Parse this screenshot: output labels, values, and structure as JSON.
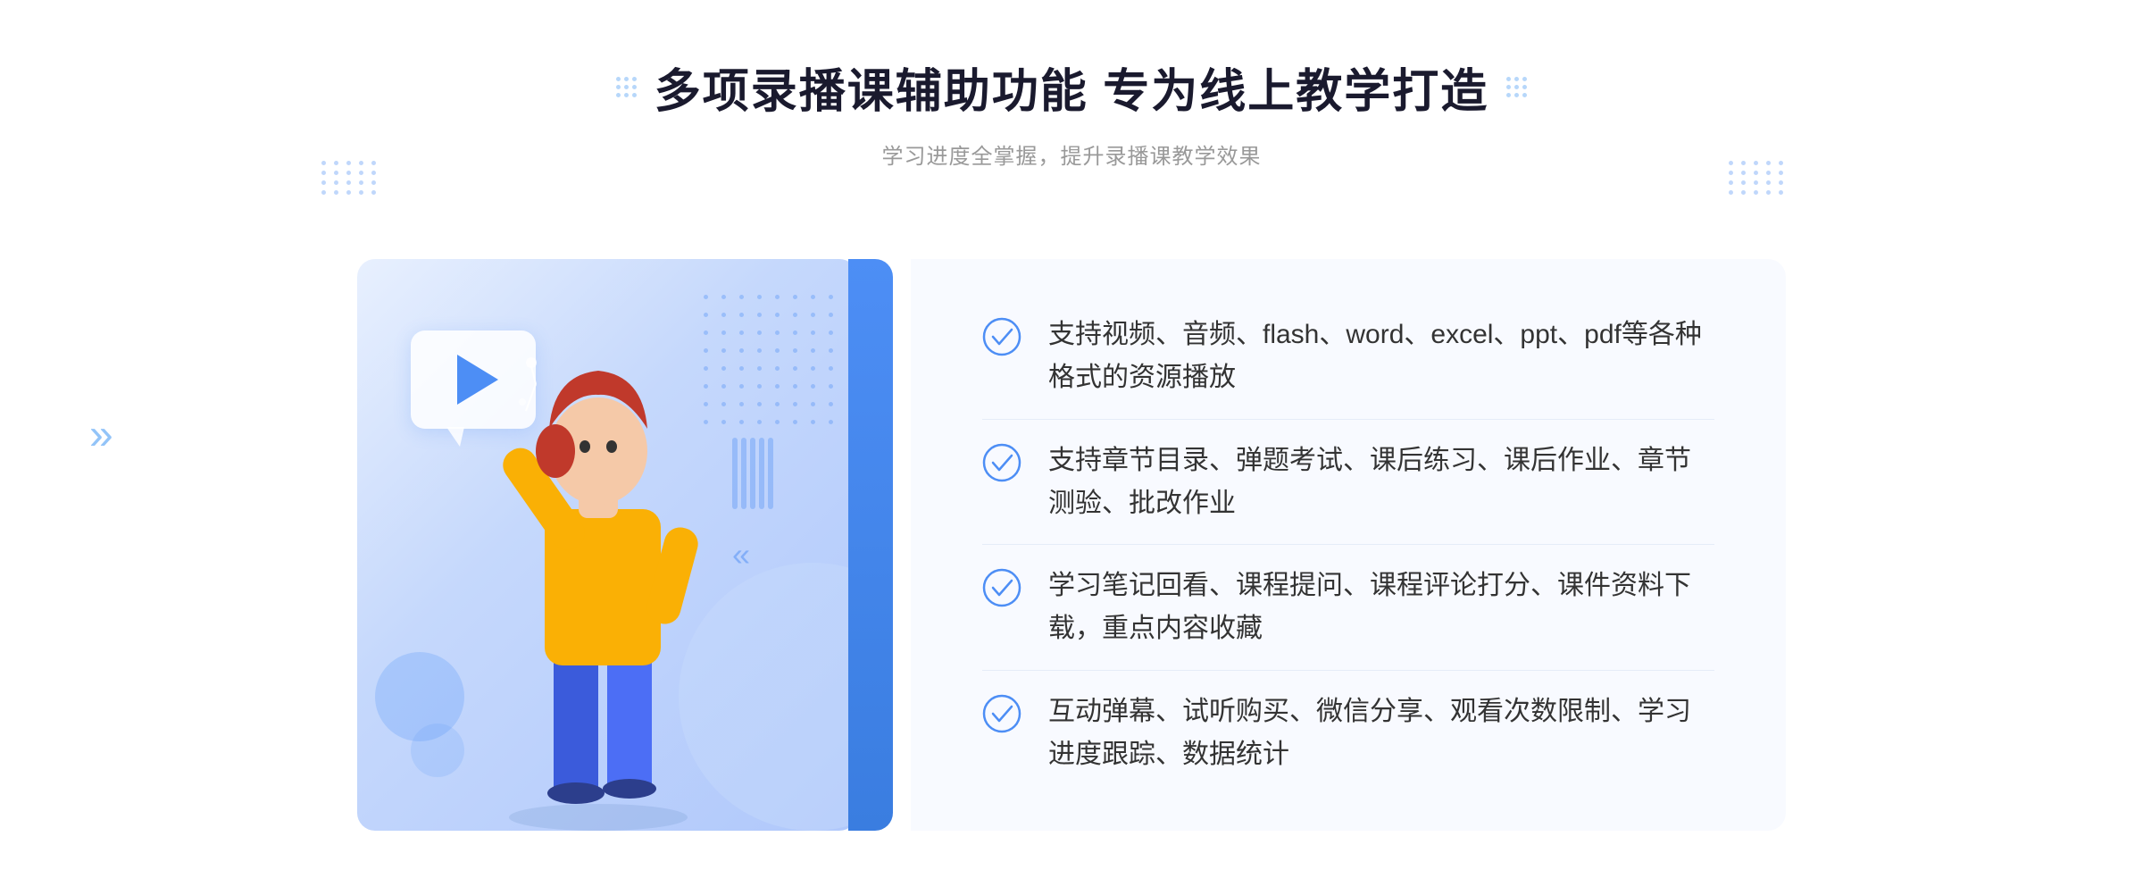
{
  "header": {
    "title": "多项录播课辅助功能 专为线上教学打造",
    "subtitle": "学习进度全掌握，提升录播课教学效果"
  },
  "features": [
    {
      "id": "feature-1",
      "text": "支持视频、音频、flash、word、excel、ppt、pdf等各种格式的资源播放"
    },
    {
      "id": "feature-2",
      "text": "支持章节目录、弹题考试、课后练习、课后作业、章节测验、批改作业"
    },
    {
      "id": "feature-3",
      "text": "学习笔记回看、课程提问、课程评论打分、课件资料下载，重点内容收藏"
    },
    {
      "id": "feature-4",
      "text": "互动弹幕、试听购买、微信分享、观看次数限制、学习进度跟踪、数据统计"
    }
  ],
  "colors": {
    "primary": "#4d8ef5",
    "title": "#1a1a2e",
    "subtitle": "#999999",
    "text": "#333333",
    "bg_light": "#f8faff",
    "check_color": "#4d8ef5"
  },
  "icons": {
    "check": "check-circle-icon",
    "play": "play-icon",
    "chevron_left": "»"
  }
}
